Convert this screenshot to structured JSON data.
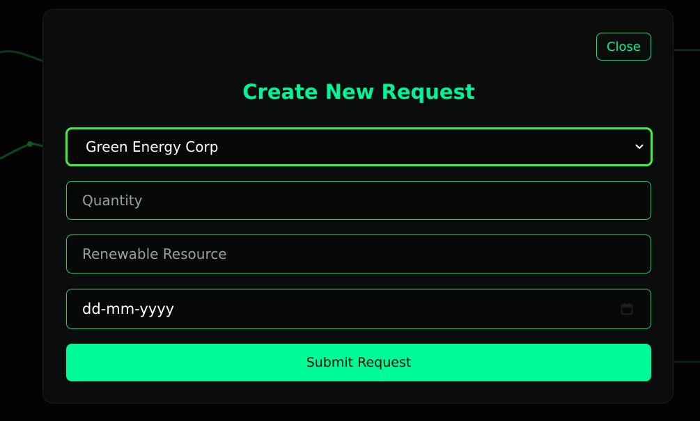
{
  "modal": {
    "close_label": "Close",
    "title": "Create New Request",
    "company_select": {
      "selected": "Green Energy Corp"
    },
    "quantity": {
      "placeholder": "Quantity"
    },
    "resource": {
      "placeholder": "Renewable Resource"
    },
    "date": {
      "placeholder": "dd-mm-yyyy"
    },
    "submit_label": "Submit Request"
  },
  "icons": {
    "select": "chevron-down-icon",
    "date": "calendar-icon"
  },
  "colors": {
    "accent": "#00f59a",
    "submit_bg": "#00fa98",
    "select_border": "#3ef03a",
    "field_border": "#1fd17a",
    "modal_bg": "#0a0d0c",
    "page_bg": "#000000"
  }
}
